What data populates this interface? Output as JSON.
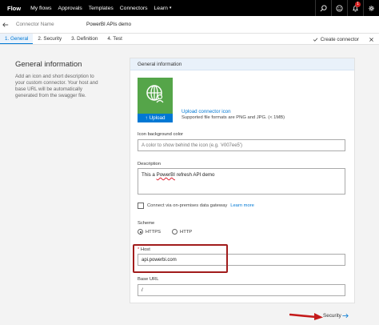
{
  "nav": {
    "brand": "Flow",
    "links": [
      "My flows",
      "Approvals",
      "Templates",
      "Connectors",
      "Learn"
    ],
    "notification_count": "1"
  },
  "header": {
    "connector_name_placeholder": "Connector Name",
    "connector_title": "PowerBI APIs demo"
  },
  "steps": {
    "items": [
      "1. General",
      "2. Security",
      "3. Definition",
      "4. Test"
    ],
    "create_connector": "Create connector"
  },
  "intro": {
    "title": "General information",
    "text": "Add an icon and short description to your custom connector. Your host and base URL will be automatically generated from the swagger file."
  },
  "form": {
    "panel_title": "General information",
    "upload_button": "Upload",
    "upload_link": "Upload connector icon",
    "upload_note": "Supported file formats are PNG and JPG. (< 1MB)",
    "icon_bg_label": "Icon background color",
    "icon_bg_placeholder": "A color to show behind the icon (e.g. '#007ee5')",
    "description_label": "Description",
    "description_pre": "This a ",
    "description_word": "PowerBI",
    "description_post": " refresh API demo",
    "gateway_label": "Connect via on-premises data gateway",
    "learn_more": "Learn more",
    "scheme_label": "Scheme",
    "scheme_https": "HTTPS",
    "scheme_http": "HTTP",
    "host_required": "*",
    "host_label": "Host",
    "host_value": "api.powerbi.com",
    "base_url_label": "Base URL",
    "base_url_value": "/"
  },
  "footer": {
    "next_label": "Security"
  },
  "colors": {
    "accent": "#0078d4",
    "icon_tile": "#55a549",
    "highlight": "#a11c1c"
  }
}
